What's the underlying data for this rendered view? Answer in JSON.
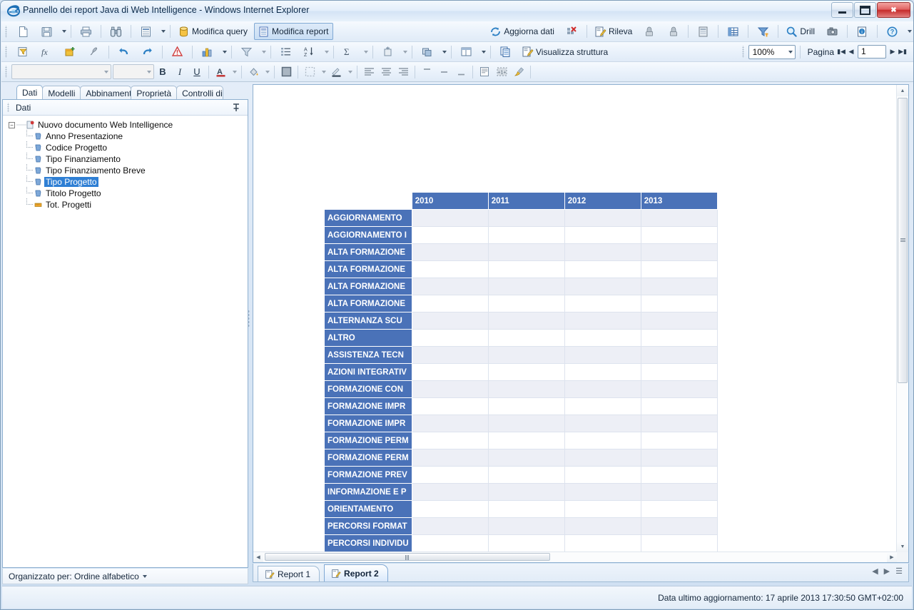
{
  "window": {
    "title": "Pannello dei report Java di Web Intelligence - Windows Internet Explorer",
    "app_icon": "internet-explorer-icon",
    "minimize_label": "–",
    "maximize_label": "□",
    "close_label": "✕"
  },
  "toolbar_main": {
    "buttons": [
      {
        "name": "new-document-button",
        "icon": "new-document-icon",
        "label": ""
      },
      {
        "name": "save-button",
        "icon": "save-disk-icon",
        "label": ""
      },
      {
        "name": "save-dropdown-button",
        "icon": "chevron-down-icon",
        "label": ""
      },
      {
        "name": "print-button",
        "icon": "printer-icon",
        "label": ""
      },
      {
        "name": "find-button",
        "icon": "binoculars-icon",
        "label": ""
      },
      {
        "name": "report-view-button",
        "icon": "page-view-icon",
        "label": ""
      },
      {
        "name": "report-view-dropdown-button",
        "icon": "chevron-down-icon",
        "label": ""
      }
    ],
    "edit_query_label": "Modifica query",
    "edit_report_label": "Modifica report",
    "refresh_label": "Aggiorna dati",
    "track_label": "Rileva",
    "drill_label": "Drill",
    "right_buttons": [
      {
        "name": "purge-data-button",
        "icon": "purge-data-icon"
      },
      {
        "name": "undo-change-button",
        "icon": "hand-undo-icon"
      },
      {
        "name": "redo-change-button",
        "icon": "hand-redo-icon"
      },
      {
        "name": "export-button",
        "icon": "export-page-icon"
      },
      {
        "name": "fold-button",
        "icon": "fold-table-icon"
      },
      {
        "name": "filter-bar-button",
        "icon": "filter-bar-icon"
      },
      {
        "name": "snapshot-button",
        "icon": "camera-icon"
      },
      {
        "name": "document-info-button",
        "icon": "info-document-icon"
      },
      {
        "name": "help-button",
        "icon": "help-question-icon"
      },
      {
        "name": "help-dropdown-button",
        "icon": "chevron-down-icon"
      }
    ]
  },
  "toolbar_report": {
    "buttons": [
      {
        "name": "query-filter-button",
        "icon": "query-filter-icon"
      },
      {
        "name": "formula-editor-button",
        "icon": "fx-icon"
      },
      {
        "name": "new-variable-button",
        "icon": "new-variable-icon"
      },
      {
        "name": "format-painter-button",
        "icon": "paintbrush-icon"
      },
      {
        "name": "undo-button",
        "icon": "undo-arrow-icon"
      },
      {
        "name": "redo-button",
        "icon": "redo-arrow-icon"
      },
      {
        "name": "alerter-button",
        "icon": "warning-triangle-icon"
      },
      {
        "name": "chart-button",
        "icon": "bar-chart-icon"
      },
      {
        "name": "chart-dropdown-button",
        "icon": "chevron-down-icon"
      },
      {
        "name": "filter-button",
        "icon": "funnel-icon"
      },
      {
        "name": "filter-dropdown-button",
        "icon": "chevron-down-icon"
      },
      {
        "name": "break-button",
        "icon": "break-icon"
      },
      {
        "name": "sort-button",
        "icon": "sort-az-icon"
      },
      {
        "name": "sort-dropdown-button",
        "icon": "chevron-down-icon"
      },
      {
        "name": "sum-button",
        "icon": "sigma-icon"
      },
      {
        "name": "sum-dropdown-button",
        "icon": "chevron-down-icon"
      },
      {
        "name": "insert-cell-button",
        "icon": "insert-cell-icon"
      },
      {
        "name": "insert-cell-dropdown-button",
        "icon": "chevron-down-icon"
      },
      {
        "name": "arrange-button",
        "icon": "arrange-icon"
      },
      {
        "name": "arrange-dropdown-button",
        "icon": "chevron-down-icon"
      },
      {
        "name": "page-layout-button",
        "icon": "page-layout-icon"
      },
      {
        "name": "page-layout-dropdown-button",
        "icon": "chevron-down-icon"
      },
      {
        "name": "duplicate-report-button",
        "icon": "duplicate-report-icon"
      }
    ],
    "structure_label": "Visualizza struttura",
    "zoom_value": "100%",
    "page_label": "Pagina",
    "page_value": "1"
  },
  "toolbar_format": {
    "font_value": "",
    "font_placeholder": "",
    "size_value": "",
    "bold_label": "B",
    "italic_label": "I",
    "underline_label": "U",
    "font_color_label": "A",
    "buttons": [
      {
        "name": "font-color-button",
        "icon": "font-color-icon"
      },
      {
        "name": "fill-color-button",
        "icon": "fill-color-icon"
      },
      {
        "name": "border-button",
        "icon": "border-icon"
      },
      {
        "name": "border-style-button",
        "icon": "border-style-icon"
      },
      {
        "name": "border-color-button",
        "icon": "border-color-icon"
      },
      {
        "name": "align-left-button",
        "icon": "align-left-icon"
      },
      {
        "name": "align-center-button",
        "icon": "align-center-icon"
      },
      {
        "name": "align-right-button",
        "icon": "align-right-icon"
      },
      {
        "name": "align-top-button",
        "icon": "align-top-icon"
      },
      {
        "name": "align-middle-button",
        "icon": "align-middle-icon"
      },
      {
        "name": "align-bottom-button",
        "icon": "align-bottom-icon"
      },
      {
        "name": "wrap-text-button",
        "icon": "wrap-text-icon"
      },
      {
        "name": "merge-cells-button",
        "icon": "merge-cells-icon"
      },
      {
        "name": "clear-format-button",
        "icon": "clear-format-icon"
      }
    ]
  },
  "left_panel": {
    "tabs": [
      {
        "label": "Dati",
        "selected": true
      },
      {
        "label": "Modelli",
        "selected": false
      },
      {
        "label": "Abbinamento",
        "selected": false
      },
      {
        "label": "Proprietà",
        "selected": false
      },
      {
        "label": "Controlli di ..",
        "selected": false
      }
    ],
    "header_title": "Dati",
    "pin_icon": "pin-icon",
    "tree_root": "Nuovo documento Web Intelligence",
    "tree_items": [
      {
        "label": "Anno Presentazione",
        "icon": "dimension-icon",
        "selected": false
      },
      {
        "label": "Codice Progetto",
        "icon": "dimension-icon",
        "selected": false
      },
      {
        "label": "Tipo Finanziamento",
        "icon": "dimension-icon",
        "selected": false
      },
      {
        "label": "Tipo Finanziamento Breve",
        "icon": "dimension-icon",
        "selected": false
      },
      {
        "label": "Tipo Progetto",
        "icon": "dimension-icon",
        "selected": true
      },
      {
        "label": "Titolo Progetto",
        "icon": "dimension-icon",
        "selected": false
      },
      {
        "label": "Tot. Progetti",
        "icon": "measure-icon",
        "selected": false
      }
    ],
    "status_text": "Organizzato per: Ordine alfabetico"
  },
  "report": {
    "tabs": [
      {
        "label": "Report 1",
        "selected": false,
        "icon": "report-icon"
      },
      {
        "label": "Report 2",
        "selected": true,
        "icon": "report-icon"
      }
    ]
  },
  "chart_data": {
    "type": "table",
    "title": "",
    "corner_label": "",
    "columns": [
      "2010",
      "2011",
      "2012",
      "2013"
    ],
    "rows": [
      "AGGIORNAMENTO",
      "AGGIORNAMENTO I",
      "ALTA FORMAZIONE",
      "ALTA FORMAZIONE",
      "ALTA FORMAZIONE",
      "ALTA FORMAZIONE",
      "ALTERNANZA SCU",
      "ALTRO",
      "ASSISTENZA TECN",
      "AZIONI INTEGRATIV",
      "FORMAZIONE CON",
      "FORMAZIONE IMPR",
      "FORMAZIONE IMPR",
      "FORMAZIONE PERM",
      "FORMAZIONE PERM",
      "FORMAZIONE PREV",
      "INFORMAZIONE E P",
      "ORIENTAMENTO",
      "PERCORSI FORMAT",
      "PERCORSI INDIVIDU"
    ],
    "values": [
      [
        "",
        "",
        "",
        ""
      ],
      [
        "",
        "",
        "",
        ""
      ],
      [
        "",
        "",
        "",
        ""
      ],
      [
        "",
        "",
        "",
        ""
      ],
      [
        "",
        "",
        "",
        ""
      ],
      [
        "",
        "",
        "",
        ""
      ],
      [
        "",
        "",
        "",
        ""
      ],
      [
        "",
        "",
        "",
        ""
      ],
      [
        "",
        "",
        "",
        ""
      ],
      [
        "",
        "",
        "",
        ""
      ],
      [
        "",
        "",
        "",
        ""
      ],
      [
        "",
        "",
        "",
        ""
      ],
      [
        "",
        "",
        "",
        ""
      ],
      [
        "",
        "",
        "",
        ""
      ],
      [
        "",
        "",
        "",
        ""
      ],
      [
        "",
        "",
        "",
        ""
      ],
      [
        "",
        "",
        "",
        ""
      ],
      [
        "",
        "",
        "",
        ""
      ],
      [
        "",
        "",
        "",
        ""
      ],
      [
        "",
        "",
        "",
        ""
      ]
    ],
    "header_color": "#4a72b8",
    "alt_row_color": "#edeff6"
  },
  "statusbar": {
    "last_update": "Data ultimo aggiornamento: 17 aprile 2013 17:30:50 GMT+02:00"
  }
}
